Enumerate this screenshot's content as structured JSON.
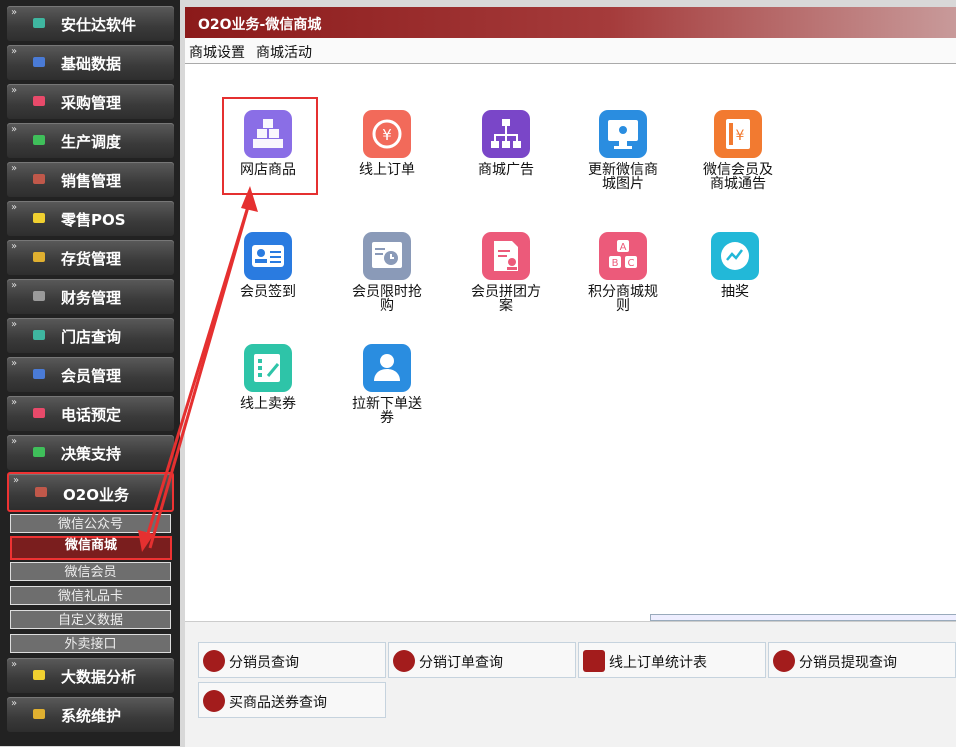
{
  "sidebar": {
    "items": [
      {
        "label": "安仕达软件",
        "color": "#3fb6a0"
      },
      {
        "label": "基础数据",
        "color": "#4a7bd6"
      },
      {
        "label": "采购管理",
        "color": "#e84a6a"
      },
      {
        "label": "生产调度",
        "color": "#3fbf5a"
      },
      {
        "label": "销售管理",
        "color": "#c0584a"
      },
      {
        "label": "零售POS",
        "color": "#f0d030"
      },
      {
        "label": "存货管理",
        "color": "#e0b030"
      },
      {
        "label": "财务管理",
        "color": "#9a9a9a"
      },
      {
        "label": "门店查询",
        "color": "#3fb6a0"
      },
      {
        "label": "会员管理",
        "color": "#4a7bd6"
      },
      {
        "label": "电话预定",
        "color": "#e84a6a"
      },
      {
        "label": "决策支持",
        "color": "#3fbf5a"
      },
      {
        "label": "O2O业务",
        "color": "#c0584a"
      },
      {
        "label": "大数据分析",
        "color": "#f0d030"
      },
      {
        "label": "系统维护",
        "color": "#e0b030"
      }
    ],
    "sub_items": [
      "微信公众号",
      "微信商城",
      "微信会员",
      "微信礼品卡",
      "自定义数据",
      "外卖接口"
    ]
  },
  "header": {
    "title": "O2O业务-微信商城"
  },
  "menu": [
    "商城设置",
    "商城活动"
  ],
  "tiles": [
    {
      "l1": "网店商品",
      "l2": "",
      "color": "#8a6ee6",
      "icon": "cubes-icon"
    },
    {
      "l1": "线上订单",
      "l2": "",
      "color": "#f26a5a",
      "icon": "yen-refresh-icon"
    },
    {
      "l1": "商城广告",
      "l2": "",
      "color": "#7a46c8",
      "icon": "org-chart-icon"
    },
    {
      "l1": "更新微信商",
      "l2": "城图片",
      "color": "#2a8de0",
      "icon": "monitor-icon"
    },
    {
      "l1": "微信会员及",
      "l2": "商城通告",
      "color": "#f27a30",
      "icon": "receipt-icon"
    },
    {
      "l1": "会员签到",
      "l2": "",
      "color": "#2a7be0",
      "icon": "id-card-icon"
    },
    {
      "l1": "会员限时抢",
      "l2": "购",
      "color": "#8a9ab8",
      "icon": "clock-screen-icon"
    },
    {
      "l1": "会员拼团方",
      "l2": "案",
      "color": "#ec5a7a",
      "icon": "doc-user-icon"
    },
    {
      "l1": "积分商城规",
      "l2": "则",
      "color": "#ec5a7a",
      "icon": "abc-blocks-icon"
    },
    {
      "l1": "抽奖",
      "l2": "",
      "color": "#22b8d8",
      "icon": "chart-circle-icon"
    },
    {
      "l1": "线上卖券",
      "l2": "",
      "color": "#2ec4a8",
      "icon": "edit-grid-icon"
    },
    {
      "l1": "拉新下单送",
      "l2": "券",
      "color": "#2a8de0",
      "icon": "users-icon"
    }
  ],
  "reports": [
    "分销员查询",
    "分销订单查询",
    "线上订单统计表",
    "分销员提现查询",
    "买商品送券查询"
  ]
}
